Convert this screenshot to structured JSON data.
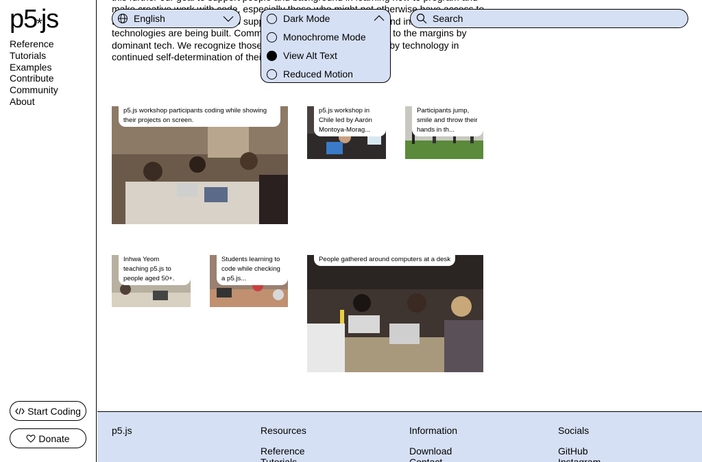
{
  "sidebar": {
    "logo_text": "p5",
    "logo_suffix": "js",
    "nav": [
      "Reference",
      "Tutorials",
      "Examples",
      "Contribute",
      "Community",
      "About"
    ],
    "start_coding": "Start Coding",
    "donate": "Donate"
  },
  "intro": {
    "line1": "...",
    "text": "this further our goal to support people and background in learning how to program and make creative work with code, especially those who might not otherwise have access to these tools. We are working to support those most marginalized and innovative technologies are being built. Communities that have been pushed to the margins by dominant tech. We recognize those who have been marginalized by technology in continued self-determination of their own space, and resources."
  },
  "controls": {
    "language": "English",
    "a11y_options": [
      {
        "label": "Dark Mode",
        "checked": false
      },
      {
        "label": "Monochrome Mode",
        "checked": false
      },
      {
        "label": "View Alt Text",
        "checked": true
      },
      {
        "label": "Reduced Motion",
        "checked": false
      }
    ],
    "search_label": "Search"
  },
  "gallery": [
    {
      "caption": "p5.js workshop participants coding while showing their projects on screen."
    },
    {
      "caption": "p5.js workshop in Chile led by Aarón Montoya-Morag..."
    },
    {
      "caption": "Participants jump, smile and throw their hands in th..."
    },
    {
      "caption": "Inhwa Yeom teaching p5.js to people aged 50+."
    },
    {
      "caption": "Students learning to code while checking a p5.js..."
    },
    {
      "caption": "People gathered around computers at a desk"
    }
  ],
  "footer": {
    "brand": "p5.js",
    "columns": [
      {
        "title": "Resources",
        "links": [
          "Reference",
          "Tutorials"
        ]
      },
      {
        "title": "Information",
        "links": [
          "Download",
          "Contact"
        ]
      },
      {
        "title": "Socials",
        "links": [
          "GitHub",
          "Instagram"
        ]
      }
    ]
  },
  "colors": {
    "accent": "#d6e0f4",
    "border": "#000000",
    "background": "#ffffff"
  }
}
